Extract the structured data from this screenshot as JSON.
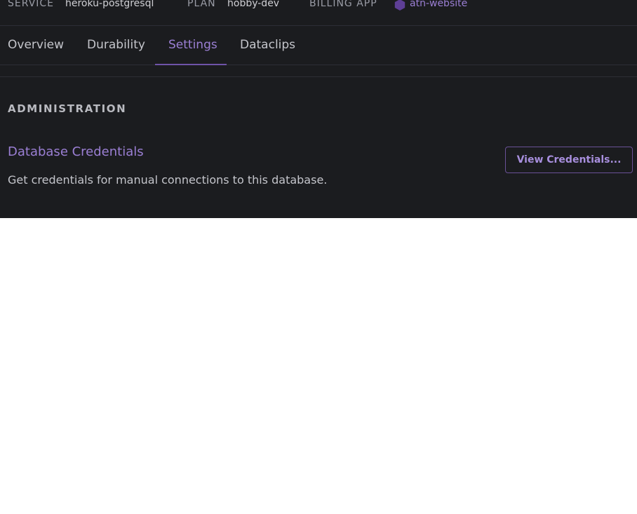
{
  "meta": {
    "service_label": "SERVICE",
    "service_value": "heroku-postgresql",
    "plan_label": "PLAN",
    "plan_value": "hobby-dev",
    "billing_label": "BILLING APP",
    "billing_app_icon": "hexagon-app-icon",
    "billing_app_value": "atn-website"
  },
  "tabs": [
    {
      "label": "Overview",
      "active": false
    },
    {
      "label": "Durability",
      "active": false
    },
    {
      "label": "Settings",
      "active": true
    },
    {
      "label": "Dataclips",
      "active": false
    }
  ],
  "administration": {
    "heading": "ADMINISTRATION",
    "credentials": {
      "title": "Database Credentials",
      "description": "Get credentials for manual connections to this database.",
      "button_label": "View Credentials..."
    }
  },
  "colors": {
    "background": "#1b1c1f",
    "accent": "#9b7fd4",
    "text": "#c4c5cb",
    "divider": "#2d2e36"
  }
}
